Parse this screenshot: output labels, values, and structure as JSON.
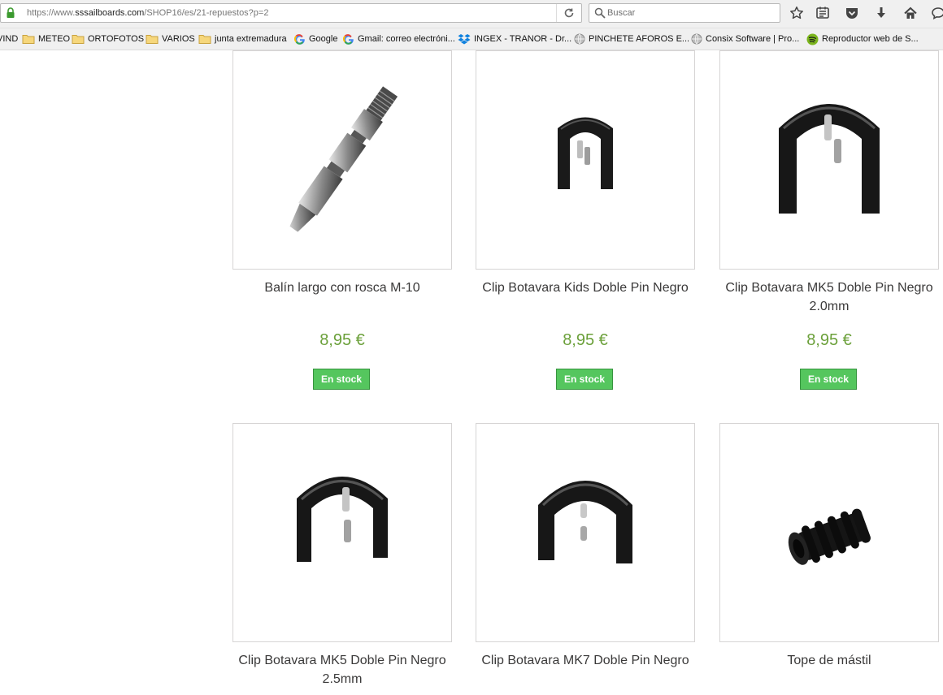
{
  "browser": {
    "url_prefix": "https://www.",
    "url_host": "sssailboards.com",
    "url_path": "/SHOP16/es/21-repuestos?p=2",
    "search_placeholder": "Buscar"
  },
  "bookmarks": [
    {
      "label": "VIND",
      "icon": "folder-icon"
    },
    {
      "label": "METEO",
      "icon": "folder-icon"
    },
    {
      "label": "ORTOFOTOS",
      "icon": "folder-icon"
    },
    {
      "label": "VARIOS",
      "icon": "folder-icon"
    },
    {
      "label": "junta extremadura",
      "icon": "folder-icon"
    },
    {
      "label": "Google",
      "icon": "google-icon"
    },
    {
      "label": "Gmail: correo electróni...",
      "icon": "google-icon"
    },
    {
      "label": "INGEX - TRANOR - Dr...",
      "icon": "dropbox-icon"
    },
    {
      "label": "PINCHETE AFOROS E...",
      "icon": "globe-icon"
    },
    {
      "label": "Consix Software | Pro...",
      "icon": "globe-icon"
    },
    {
      "label": "Reproductor web de S...",
      "icon": "spotify-icon"
    }
  ],
  "products": [
    {
      "name": "Balín largo con rosca M-10",
      "price": "8,95 €",
      "stock": "En stock",
      "image": "screw-pin"
    },
    {
      "name": "Clip Botavara Kids Doble Pin Negro",
      "price": "8,95 €",
      "stock": "En stock",
      "image": "clip-small"
    },
    {
      "name": "Clip Botavara MK5 Doble Pin Negro 2.0mm",
      "price": "8,95 €",
      "stock": "En stock",
      "image": "clip-large"
    },
    {
      "name": "Clip Botavara MK5 Doble Pin Negro 2.5mm",
      "image": "clip-large"
    },
    {
      "name": "Clip Botavara MK7 Doble Pin Negro",
      "image": "clip-large"
    },
    {
      "name": "Tope de mástil",
      "image": "mast-stopper"
    }
  ],
  "colors": {
    "price": "#6ba03a",
    "stock_badge": "#55c65e",
    "name": "#3a3939"
  }
}
